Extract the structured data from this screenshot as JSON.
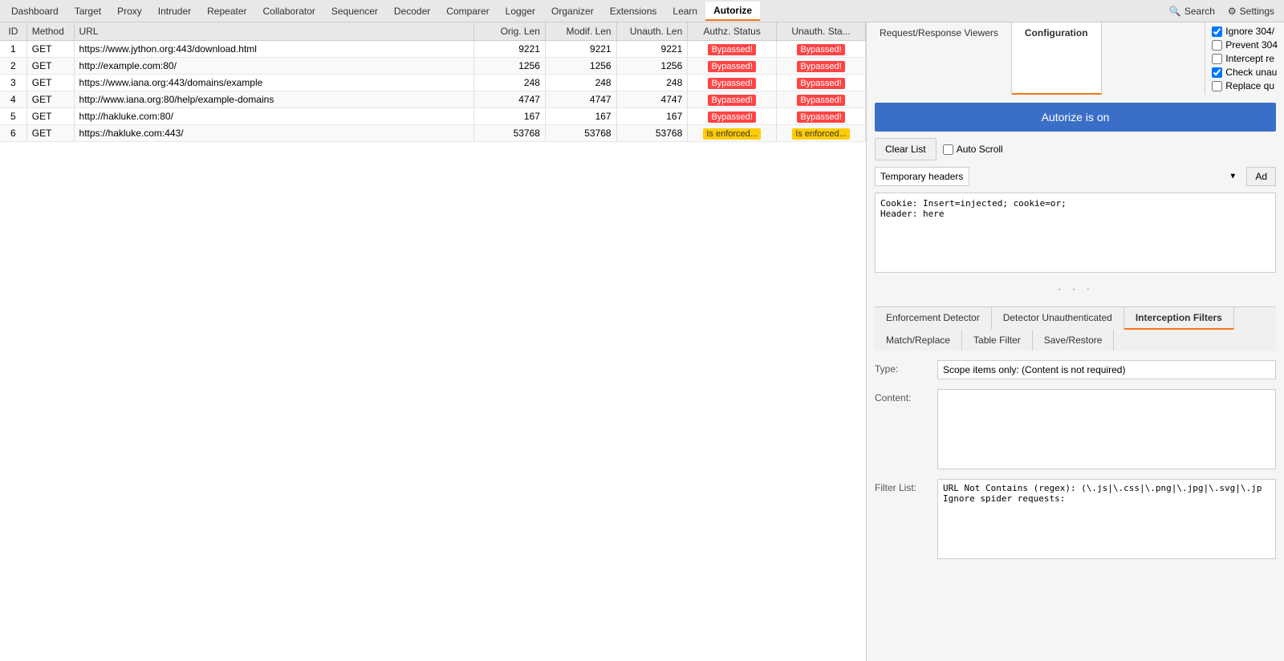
{
  "menu": {
    "items": [
      {
        "label": "Dashboard",
        "active": false
      },
      {
        "label": "Target",
        "active": false
      },
      {
        "label": "Proxy",
        "active": false
      },
      {
        "label": "Intruder",
        "active": false
      },
      {
        "label": "Repeater",
        "active": false
      },
      {
        "label": "Collaborator",
        "active": false
      },
      {
        "label": "Sequencer",
        "active": false
      },
      {
        "label": "Decoder",
        "active": false
      },
      {
        "label": "Comparer",
        "active": false
      },
      {
        "label": "Logger",
        "active": false
      },
      {
        "label": "Organizer",
        "active": false
      },
      {
        "label": "Extensions",
        "active": false
      },
      {
        "label": "Learn",
        "active": false
      },
      {
        "label": "Autorize",
        "active": true
      }
    ],
    "search_label": "Search",
    "settings_label": "Settings"
  },
  "table": {
    "columns": [
      "ID",
      "Method",
      "URL",
      "Orig. Len",
      "Modif. Len",
      "Unauth. Len",
      "Authz. Status",
      "Unauth. Sta..."
    ],
    "rows": [
      {
        "id": "1",
        "method": "GET",
        "url": "https://www.jython.org:443/download.html",
        "orig_len": "9221",
        "modif_len": "9221",
        "unauth_len": "9221",
        "authz_status": "Bypassed!",
        "unauth_status": "Bypassed!",
        "authz_color": "red",
        "unauth_color": "red"
      },
      {
        "id": "2",
        "method": "GET",
        "url": "http://example.com:80/",
        "orig_len": "1256",
        "modif_len": "1256",
        "unauth_len": "1256",
        "authz_status": "Bypassed!",
        "unauth_status": "Bypassed!",
        "authz_color": "red",
        "unauth_color": "red"
      },
      {
        "id": "3",
        "method": "GET",
        "url": "https://www.iana.org:443/domains/example",
        "orig_len": "248",
        "modif_len": "248",
        "unauth_len": "248",
        "authz_status": "Bypassed!",
        "unauth_status": "Bypassed!",
        "authz_color": "red",
        "unauth_color": "red"
      },
      {
        "id": "4",
        "method": "GET",
        "url": "http://www.iana.org:80/help/example-domains",
        "orig_len": "4747",
        "modif_len": "4747",
        "unauth_len": "4747",
        "authz_status": "Bypassed!",
        "unauth_status": "Bypassed!",
        "authz_color": "red",
        "unauth_color": "red"
      },
      {
        "id": "5",
        "method": "GET",
        "url": "http://hakluke.com:80/",
        "orig_len": "167",
        "modif_len": "167",
        "unauth_len": "167",
        "authz_status": "Bypassed!",
        "unauth_status": "Bypassed!",
        "authz_color": "red",
        "unauth_color": "red"
      },
      {
        "id": "6",
        "method": "GET",
        "url": "https://hakluke.com:443/",
        "orig_len": "53768",
        "modif_len": "53768",
        "unauth_len": "53768",
        "authz_status": "Is enforced...",
        "unauth_status": "Is enforced...",
        "authz_color": "yellow",
        "unauth_color": "yellow"
      }
    ]
  },
  "right_panel": {
    "tabs": [
      {
        "label": "Request/Response Viewers",
        "active": false
      },
      {
        "label": "Configuration",
        "active": true
      }
    ],
    "checkboxes": [
      {
        "label": "Ignore 304/",
        "checked": true
      },
      {
        "label": "Prevent 304",
        "checked": false
      },
      {
        "label": "Intercept re",
        "checked": false
      },
      {
        "label": "Check unau",
        "checked": true
      },
      {
        "label": "Replace qu",
        "checked": false
      }
    ],
    "autorize_button": "Autorize is on",
    "clear_list_button": "Clear List",
    "auto_scroll_label": "Auto Scroll",
    "auto_scroll_checked": false,
    "dropdown_label": "Temporary headers",
    "add_button": "Ad",
    "headers_content": "Cookie: Insert=injected; cookie=or;\nHeader: here",
    "bottom_tabs": [
      {
        "label": "Enforcement Detector",
        "active": false
      },
      {
        "label": "Detector Unauthenticated",
        "active": false
      },
      {
        "label": "Interception Filters",
        "active": true
      },
      {
        "label": "Match/Replace",
        "active": false
      },
      {
        "label": "Table Filter",
        "active": false
      },
      {
        "label": "Save/Restore",
        "active": false
      }
    ],
    "type_label": "Type:",
    "type_value": "Scope items only: (Content is not required)",
    "content_label": "Content:",
    "content_value": "",
    "filter_list_label": "Filter List:",
    "filter_list_value": "URL Not Contains (regex): (\\.js|\\.css|\\.png|\\.jpg|\\.svg|\\.jp\nIgnore spider requests:"
  }
}
